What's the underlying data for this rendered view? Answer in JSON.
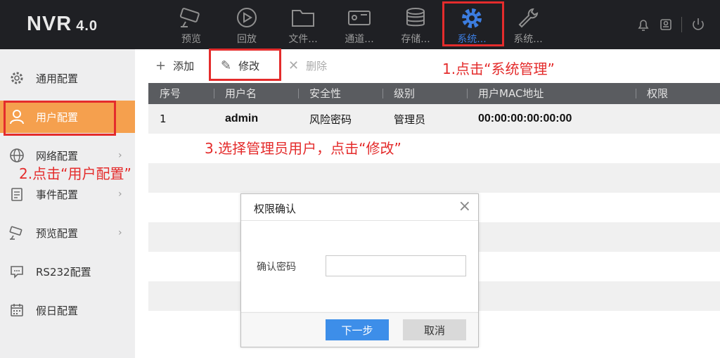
{
  "header": {
    "logo": "NVR",
    "version": "4.0",
    "nav": [
      {
        "label": "预览",
        "icon": "camera-icon"
      },
      {
        "label": "回放",
        "icon": "playback-icon"
      },
      {
        "label": "文件...",
        "icon": "folder-icon"
      },
      {
        "label": "通道...",
        "icon": "channel-icon"
      },
      {
        "label": "存储...",
        "icon": "storage-icon"
      },
      {
        "label": "系统...",
        "icon": "gear-icon",
        "active": true
      },
      {
        "label": "系统...",
        "icon": "wrench-icon"
      }
    ]
  },
  "sidebar": {
    "items": [
      {
        "label": "通用配置",
        "icon": "gear-icon"
      },
      {
        "label": "用户配置",
        "icon": "user-icon",
        "active": true
      },
      {
        "label": "网络配置",
        "icon": "globe-icon",
        "arrow": "›"
      },
      {
        "label": "事件配置",
        "icon": "clipboard-icon",
        "arrow": "›"
      },
      {
        "label": "预览配置",
        "icon": "camera-icon",
        "arrow": "›"
      },
      {
        "label": "RS232配置",
        "icon": "chat-icon"
      },
      {
        "label": "假日配置",
        "icon": "calendar-icon"
      }
    ]
  },
  "toolbar": {
    "add": {
      "glyph": "+",
      "label": "添加"
    },
    "edit": {
      "glyph": "✎",
      "label": "修改"
    },
    "delete": {
      "glyph": "✕",
      "label": "删除"
    }
  },
  "table": {
    "columns": [
      "序号",
      "用户名",
      "安全性",
      "级别",
      "用户MAC地址",
      "权限"
    ],
    "rows": [
      [
        "1",
        "admin",
        "风险密码",
        "管理员",
        "00:00:00:00:00:00",
        ""
      ]
    ]
  },
  "annotations": {
    "step1": "1.点击“系统管理”",
    "step2": "2.点击“用户配置”",
    "step3": "3.选择管理员用户，点击“修改”"
  },
  "dialog": {
    "title": "权限确认",
    "close": "×",
    "password_label": "确认密码",
    "password_value": "",
    "next": "下一步",
    "cancel": "取消"
  },
  "colors": {
    "accent": "#3c7de0",
    "sidebar_active": "#f5a04e",
    "annotation_red": "#e42c2c",
    "topbar_bg": "#1f2024",
    "table_header": "#5a5c60"
  }
}
